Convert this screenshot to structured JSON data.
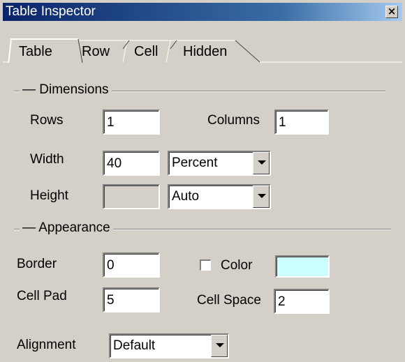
{
  "window": {
    "title": "Table Inspector"
  },
  "tabs": [
    {
      "label": "Table"
    },
    {
      "label": "Row"
    },
    {
      "label": "Cell"
    },
    {
      "label": "Hidden"
    }
  ],
  "dimensions": {
    "group_label": "Dimensions",
    "rows_label": "Rows",
    "rows_value": "1",
    "columns_label": "Columns",
    "columns_value": "1",
    "width_label": "Width",
    "width_value": "40",
    "width_unit": "Percent",
    "height_label": "Height",
    "height_value": "",
    "height_unit": "Auto"
  },
  "appearance": {
    "group_label": "Appearance",
    "border_label": "Border",
    "border_value": "0",
    "color_label": "Color",
    "color_checked": false,
    "color_swatch": "#ccffff",
    "cellpad_label": "Cell Pad",
    "cellpad_value": "5",
    "cellspace_label": "Cell Space",
    "cellspace_value": "2",
    "alignment_label": "Alignment",
    "alignment_value": "Default"
  }
}
